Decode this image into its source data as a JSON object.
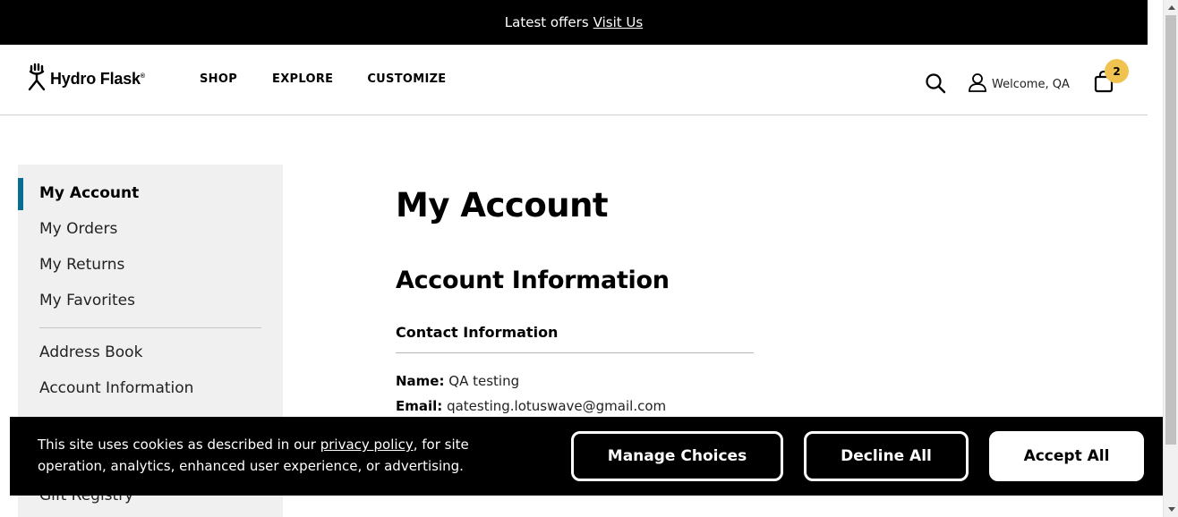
{
  "promo": {
    "text": "Latest offers",
    "link": "Visit Us"
  },
  "header": {
    "logo_text": "Hydro Flask",
    "logo_reg": "®",
    "nav": {
      "shop": "SHOP",
      "explore": "EXPLORE",
      "customize": "CUSTOMIZE"
    },
    "welcome": "Welcome, QA",
    "cart_count": "2"
  },
  "sidebar": {
    "items": [
      "My Account",
      "My Orders",
      "My Returns",
      "My Favorites",
      "Address Book",
      "Account Information",
      "Gift Registry"
    ]
  },
  "main": {
    "title": "My Account",
    "section_title": "Account Information",
    "contact_title": "Contact Information",
    "name_label": "Name:",
    "name_value": "QA testing",
    "email_label": "Email:",
    "email_value": "qatesting.lotuswave@gmail.com"
  },
  "cookie": {
    "text_before": "This site uses cookies as described in our",
    "link": "privacy policy",
    "text_after": ", for site operation, analytics, enhanced user experience, or advertising.",
    "manage": "Manage Choices",
    "decline": "Decline All",
    "accept": "Accept All"
  },
  "colors": {
    "accent_marker": "#0a6c8f",
    "cart_badge": "#f0c24f",
    "sidebar_bg": "#f0f0f0"
  }
}
